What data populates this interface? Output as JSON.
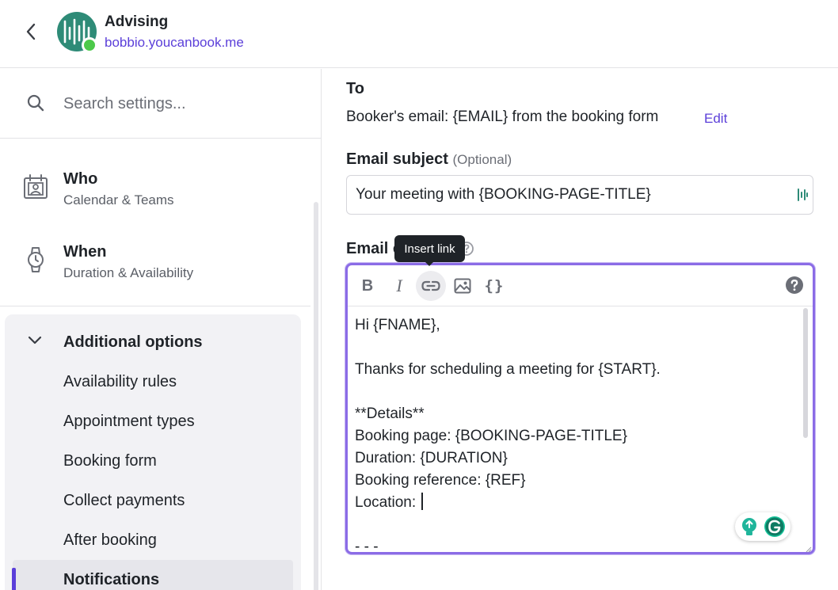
{
  "header": {
    "back_icon": "chevron-left-icon",
    "title": "Advising",
    "subtitle": "bobbio.youcanbook.me",
    "status": "online",
    "brand_color": "#5b3fd9",
    "logo_color": "#2e8b77",
    "status_color": "#4cc94a"
  },
  "sidebar": {
    "search": {
      "placeholder": "Search settings...",
      "value": "",
      "icon": "search-icon"
    },
    "sections": [
      {
        "title": "Who",
        "subtitle": "Calendar & Teams",
        "icon": "calendar-person-icon"
      },
      {
        "title": "When",
        "subtitle": "Duration & Availability",
        "icon": "watch-icon"
      }
    ],
    "additional": {
      "title": "Additional options",
      "icon": "chevron-down-icon",
      "items": [
        "Availability rules",
        "Appointment types",
        "Booking form",
        "Collect payments",
        "After booking",
        "Notifications"
      ],
      "active": "Notifications"
    }
  },
  "main": {
    "to_label": "To",
    "to_text": "Booker's email: {EMAIL} from the booking form",
    "edit_label": "Edit",
    "subject_label": "Email subject",
    "subject_optional": "(Optional)",
    "subject_value": "Your meeting with {BOOKING-PAGE-TITLE}",
    "body_label": "Email c",
    "tooltip": "Insert link",
    "toolbar": {
      "bold": "B",
      "italic": "I",
      "link_icon": "link-icon",
      "image_icon": "image-icon",
      "braces": "{}",
      "help_icon": "help-circle-icon"
    },
    "body_lines": [
      "Hi {FNAME},",
      "",
      "Thanks for scheduling a meeting for {START}.",
      "",
      "**Details**",
      "Booking page: {BOOKING-PAGE-TITLE}",
      "Duration: {DURATION}",
      "Booking reference: {REF}",
      "Location: ",
      "",
      "- - -"
    ],
    "focus_color": "#8b6ce6"
  }
}
